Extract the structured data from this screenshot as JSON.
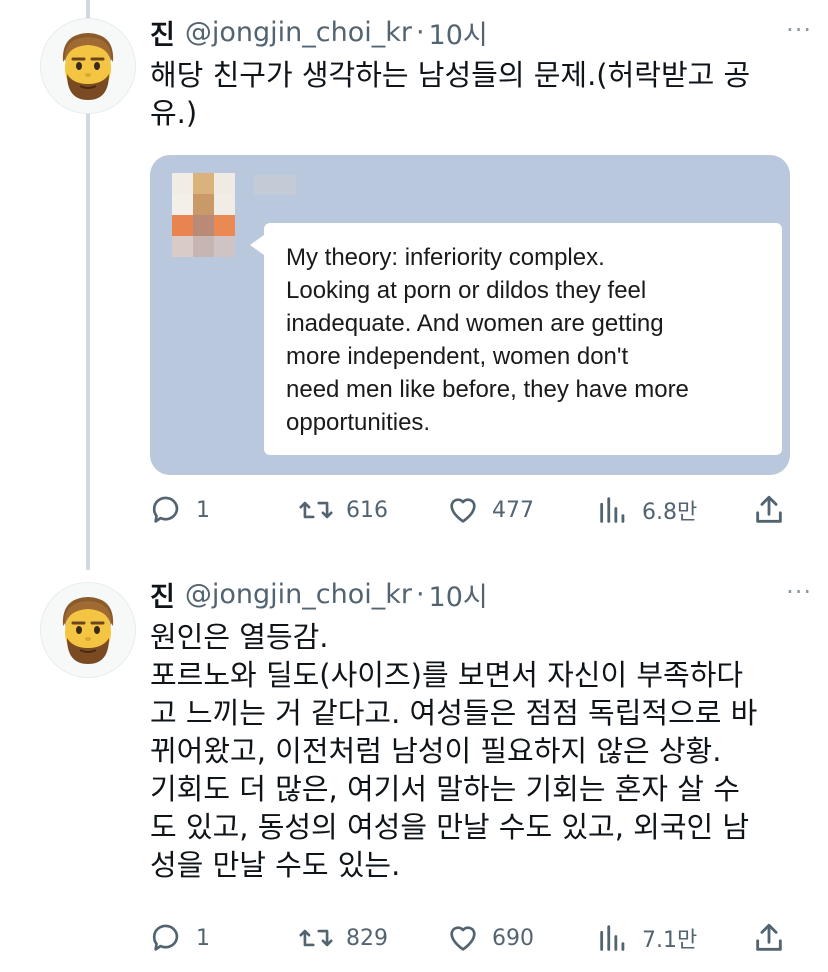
{
  "tweets": [
    {
      "name": "진",
      "handle": "@jongjin_choi_kr",
      "separator": "·",
      "time": "10시",
      "more": "···",
      "text": "해당 친구가 생각하는 남성들의 문제.(허락받고 공\n유.)",
      "media": {
        "message_text": "My theory: inferiority complex.\nLooking at porn or dildos they feel\ninadequate. And women are getting\nmore independent, women don't\nneed men like before, they have more\nopportunities."
      },
      "stats": {
        "replies": "1",
        "retweets": "616",
        "likes": "477",
        "views": "6.8만"
      }
    },
    {
      "name": "진",
      "handle": "@jongjin_choi_kr",
      "separator": "·",
      "time": "10시",
      "more": "···",
      "text": "원인은 열등감.\n포르노와 딜도(사이즈)를 보면서 자신이 부족하다\n고 느끼는 거 같다고. 여성들은 점점 독립적으로 바\n뀌어왔고, 이전처럼 남성이 필요하지 않은 상황.\n기회도 더 많은, 여기서 말하는 기회는 혼자 살 수\n도 있고, 동성의 여성을 만날 수도 있고, 외국인 남\n성을 만날 수도 있는.",
      "stats": {
        "replies": "1",
        "retweets": "829",
        "likes": "690",
        "views": "7.1만"
      }
    }
  ],
  "colors": {
    "text": "#0f1419",
    "secondary": "#536471",
    "thread_line": "#cfd9de",
    "media_bg": "#b9c8dc"
  },
  "icons": [
    "reply-icon",
    "retweet-icon",
    "like-icon",
    "views-icon",
    "share-icon",
    "avatar-emoji"
  ]
}
